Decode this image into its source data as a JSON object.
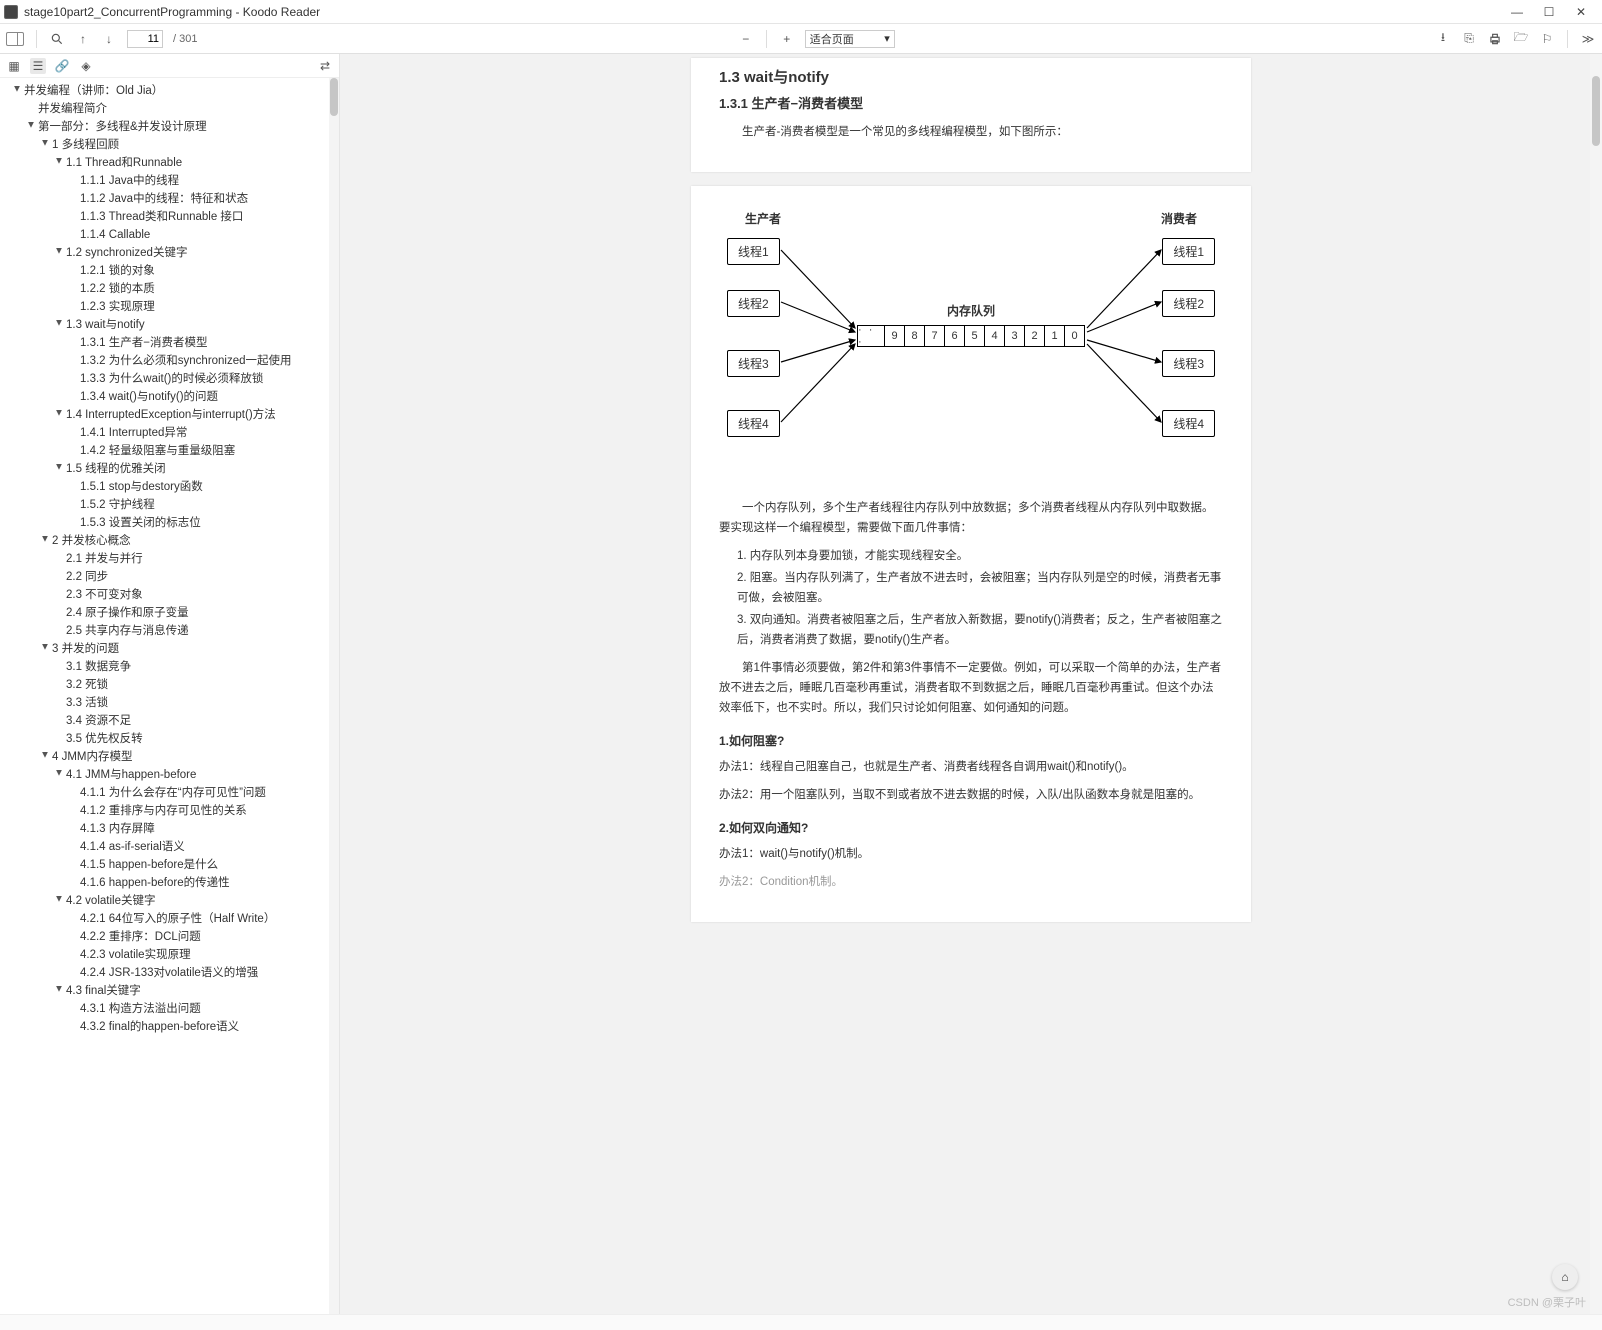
{
  "window": {
    "title": "stage10part2_ConcurrentProgramming - Koodo Reader"
  },
  "toolbar": {
    "page_current": "11",
    "page_total": "/ 301",
    "zoom_label": "适合页面"
  },
  "outline": [
    {
      "l": 0,
      "a": 1,
      "t": "并发编程（讲师：Old Jia）"
    },
    {
      "l": 1,
      "a": 0,
      "t": "并发编程简介"
    },
    {
      "l": 1,
      "a": 1,
      "t": "第一部分：多线程&并发设计原理"
    },
    {
      "l": 2,
      "a": 1,
      "t": "1 多线程回顾"
    },
    {
      "l": 3,
      "a": 1,
      "t": "1.1 Thread和Runnable"
    },
    {
      "l": 4,
      "a": 0,
      "t": "1.1.1 Java中的线程"
    },
    {
      "l": 4,
      "a": 0,
      "t": "1.1.2 Java中的线程：特征和状态"
    },
    {
      "l": 4,
      "a": 0,
      "t": "1.1.3 Thread类和Runnable 接口"
    },
    {
      "l": 4,
      "a": 0,
      "t": "1.1.4 Callable"
    },
    {
      "l": 3,
      "a": 1,
      "t": "1.2 synchronized关键字"
    },
    {
      "l": 4,
      "a": 0,
      "t": "1.2.1 锁的对象"
    },
    {
      "l": 4,
      "a": 0,
      "t": "1.2.2 锁的本质"
    },
    {
      "l": 4,
      "a": 0,
      "t": "1.2.3 实现原理"
    },
    {
      "l": 3,
      "a": 1,
      "t": "1.3 wait与notify"
    },
    {
      "l": 4,
      "a": 0,
      "t": "1.3.1 生产者−消费者模型"
    },
    {
      "l": 4,
      "a": 0,
      "t": "1.3.2 为什么必须和synchronized一起使用"
    },
    {
      "l": 4,
      "a": 0,
      "t": "1.3.3 为什么wait()的时候必须释放锁"
    },
    {
      "l": 4,
      "a": 0,
      "t": "1.3.4 wait()与notify()的问题"
    },
    {
      "l": 3,
      "a": 1,
      "t": "1.4 InterruptedException与interrupt()方法"
    },
    {
      "l": 4,
      "a": 0,
      "t": "1.4.1 Interrupted异常"
    },
    {
      "l": 4,
      "a": 0,
      "t": "1.4.2 轻量级阻塞与重量级阻塞"
    },
    {
      "l": 3,
      "a": 1,
      "t": "1.5 线程的优雅关闭"
    },
    {
      "l": 4,
      "a": 0,
      "t": "1.5.1 stop与destory函数"
    },
    {
      "l": 4,
      "a": 0,
      "t": "1.5.2 守护线程"
    },
    {
      "l": 4,
      "a": 0,
      "t": "1.5.3 设置关闭的标志位"
    },
    {
      "l": 2,
      "a": 1,
      "t": "2 并发核心概念"
    },
    {
      "l": 3,
      "a": 0,
      "t": "2.1 并发与并行"
    },
    {
      "l": 3,
      "a": 0,
      "t": "2.2 同步"
    },
    {
      "l": 3,
      "a": 0,
      "t": "2.3 不可变对象"
    },
    {
      "l": 3,
      "a": 0,
      "t": "2.4 原子操作和原子变量"
    },
    {
      "l": 3,
      "a": 0,
      "t": "2.5 共享内存与消息传递"
    },
    {
      "l": 2,
      "a": 1,
      "t": "3 并发的问题"
    },
    {
      "l": 3,
      "a": 0,
      "t": "3.1 数据竞争"
    },
    {
      "l": 3,
      "a": 0,
      "t": "3.2 死锁"
    },
    {
      "l": 3,
      "a": 0,
      "t": "3.3 活锁"
    },
    {
      "l": 3,
      "a": 0,
      "t": "3.4 资源不足"
    },
    {
      "l": 3,
      "a": 0,
      "t": "3.5 优先权反转"
    },
    {
      "l": 2,
      "a": 1,
      "t": "4 JMM内存模型"
    },
    {
      "l": 3,
      "a": 1,
      "t": "4.1 JMM与happen-before"
    },
    {
      "l": 4,
      "a": 0,
      "t": "4.1.1 为什么会存在“内存可见性”问题"
    },
    {
      "l": 4,
      "a": 0,
      "t": "4.1.2 重排序与内存可见性的关系"
    },
    {
      "l": 4,
      "a": 0,
      "t": "4.1.3 内存屏障"
    },
    {
      "l": 4,
      "a": 0,
      "t": "4.1.4 as-if-serial语义"
    },
    {
      "l": 4,
      "a": 0,
      "t": "4.1.5 happen-before是什么"
    },
    {
      "l": 4,
      "a": 0,
      "t": "4.1.6 happen-before的传递性"
    },
    {
      "l": 3,
      "a": 1,
      "t": "4.2 volatile关键字"
    },
    {
      "l": 4,
      "a": 0,
      "t": "4.2.1 64位写入的原子性（Half Write）"
    },
    {
      "l": 4,
      "a": 0,
      "t": "4.2.2 重排序：DCL问题"
    },
    {
      "l": 4,
      "a": 0,
      "t": "4.2.3 volatile实现原理"
    },
    {
      "l": 4,
      "a": 0,
      "t": "4.2.4 JSR-133对volatile语义的增强"
    },
    {
      "l": 3,
      "a": 1,
      "t": "4.3 final关键字"
    },
    {
      "l": 4,
      "a": 0,
      "t": "4.3.1 构造方法溢出问题"
    },
    {
      "l": 4,
      "a": 0,
      "t": "4.3.2 final的happen-before语义"
    }
  ],
  "doc": {
    "h_wait": "1.3 wait与notify",
    "h_model": "1.3.1 生产者−消费者模型",
    "p_intro": "生产者-消费者模型是一个常见的多线程编程模型，如下图所示：",
    "diagram": {
      "producer_title": "生产者",
      "consumer_title": "消费者",
      "queue_title": "内存队列",
      "producers": [
        "线程1",
        "线程2",
        "线程3",
        "线程4"
      ],
      "consumers": [
        "线程1",
        "线程2",
        "线程3",
        "线程4"
      ],
      "queue": [
        "· · ·",
        "9",
        "8",
        "7",
        "6",
        "5",
        "4",
        "3",
        "2",
        "1",
        "0"
      ]
    },
    "p_q1": "一个内存队列，多个生产者线程往内存队列中放数据；多个消费者线程从内存队列中取数据。要实现这样一个编程模型，需要做下面几件事情：",
    "ol": [
      "1. 内存队列本身要加锁，才能实现线程安全。",
      "2. 阻塞。当内存队列满了，生产者放不进去时，会被阻塞；当内存队列是空的时候，消费者无事可做，会被阻塞。",
      "3. 双向通知。消费者被阻塞之后，生产者放入新数据，要notify()消费者；反之，生产者被阻塞之后，消费者消费了数据，要notify()生产者。"
    ],
    "p_q2": "第1件事情必须要做，第2件和第3件事情不一定要做。例如，可以采取一个简单的办法，生产者放不进去之后，睡眠几百毫秒再重试，消费者取不到数据之后，睡眠几百毫秒再重试。但这个办法效率低下，也不实时。所以，我们只讨论如何阻塞、如何通知的问题。",
    "sub_block": "1.如何阻塞?",
    "m1": "办法1：线程自己阻塞自己，也就是生产者、消费者线程各自调用wait()和notify()。",
    "m2": "办法2：用一个阻塞队列，当取不到或者放不进去数据的时候，入队/出队函数本身就是阻塞的。",
    "sub_notify": "2.如何双向通知?",
    "n1": "办法1：wait()与notify()机制。",
    "n2": "办法2：Condition机制。"
  },
  "watermark": "CSDN @栗子叶"
}
